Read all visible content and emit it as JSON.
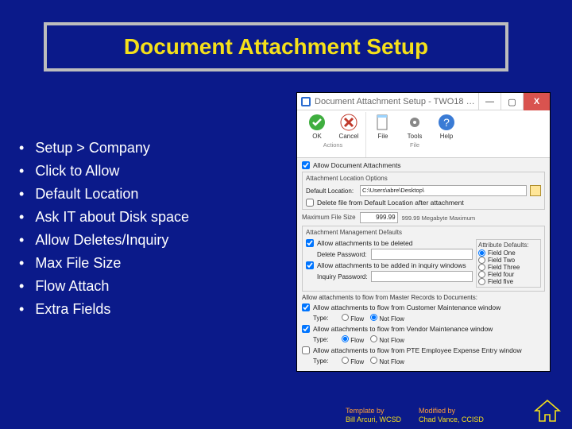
{
  "slide": {
    "title": "Document Attachment Setup",
    "bullets": [
      "Setup > Company",
      "Click to Allow",
      "Default Location",
      "Ask IT about Disk space",
      "Allow Deletes/Inquiry",
      "Max File Size",
      "Flow Attach",
      "Extra Fields"
    ]
  },
  "dialog": {
    "title": "Document Attachment Setup  -  TWO18 (st…",
    "win": {
      "min": "—",
      "max": "▢",
      "close": "X"
    },
    "ribbon": {
      "actions": {
        "ok": "OK",
        "cancel": "Cancel",
        "group": "Actions"
      },
      "filegrp": {
        "file": "File",
        "tools": "Tools",
        "help": "Help",
        "group": "File"
      }
    },
    "allow_attach": {
      "checked": true,
      "label": "Allow Document Attachments"
    },
    "location": {
      "legend": "Attachment Location Options",
      "default_label": "Default Location:",
      "default_value": "C:\\Users\\abre\\Desktop\\",
      "delete_file": {
        "checked": false,
        "label": "Delete file from Default Location after attachment"
      }
    },
    "maxsize": {
      "label": "Maximum File Size",
      "value": "999.99",
      "suffix": "999.99 Megabyte Maximum"
    },
    "mgmt": {
      "legend": "Attachment Management Defaults",
      "allow_delete": {
        "checked": true,
        "label": "Allow attachments to be deleted"
      },
      "delete_pwd_label": "Delete Password:",
      "allow_inquiry": {
        "checked": true,
        "label": "Allow attachments to be added in inquiry windows"
      },
      "inquiry_pwd_label": "Inquiry Password:",
      "attr_legend": "Attribute Defaults:",
      "attrs": [
        "Field One",
        "Field Two",
        "Field Three",
        "Field four",
        "Field five"
      ]
    },
    "flows": {
      "legend": "Allow attachments to flow from Master Records to Documents:",
      "items": [
        {
          "checked": true,
          "label": "Allow attachments to flow from Customer Maintenance window",
          "flow": true
        },
        {
          "checked": true,
          "label": "Allow attachments to flow from Vendor Maintenance window",
          "flow": true
        },
        {
          "checked": false,
          "label": "Allow attachments to flow from PTE Employee Expense Entry window",
          "flow": true
        }
      ],
      "type_label": "Type:",
      "flow_label": "Flow",
      "notflow_label": "Not Flow"
    }
  },
  "credits": {
    "template_by": "Template by",
    "template_name": "Bill Arcuri, WCSD",
    "modified_by": "Modified by",
    "modified_name": "Chad Vance, CCISD"
  }
}
